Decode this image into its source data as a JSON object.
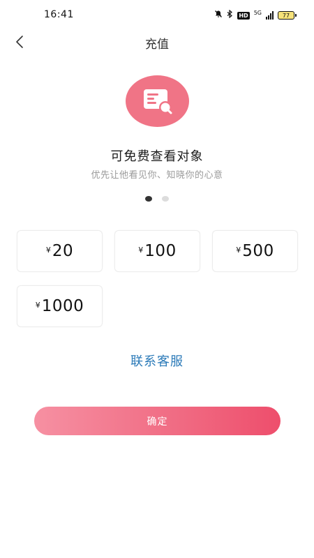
{
  "status_bar": {
    "time": "16:41",
    "hd": "HD",
    "network": "5G",
    "battery": "77"
  },
  "header": {
    "title": "充值"
  },
  "hero": {
    "icon": "chat-card-icon",
    "title": "可免费查看对象",
    "subtitle": "优先让他看见你、知晓你的心意",
    "carousel": {
      "pages": 2,
      "active": 1
    }
  },
  "amounts": [
    {
      "currency": "¥",
      "value": "20"
    },
    {
      "currency": "¥",
      "value": "100"
    },
    {
      "currency": "¥",
      "value": "500"
    },
    {
      "currency": "¥",
      "value": "1000"
    }
  ],
  "contact": {
    "label": "联系客服"
  },
  "confirm": {
    "label": "确定"
  },
  "colors": {
    "accent": "#f07486",
    "button_start": "#f690a2",
    "button_end": "#ee4e6c",
    "link": "#2b7ab8"
  }
}
